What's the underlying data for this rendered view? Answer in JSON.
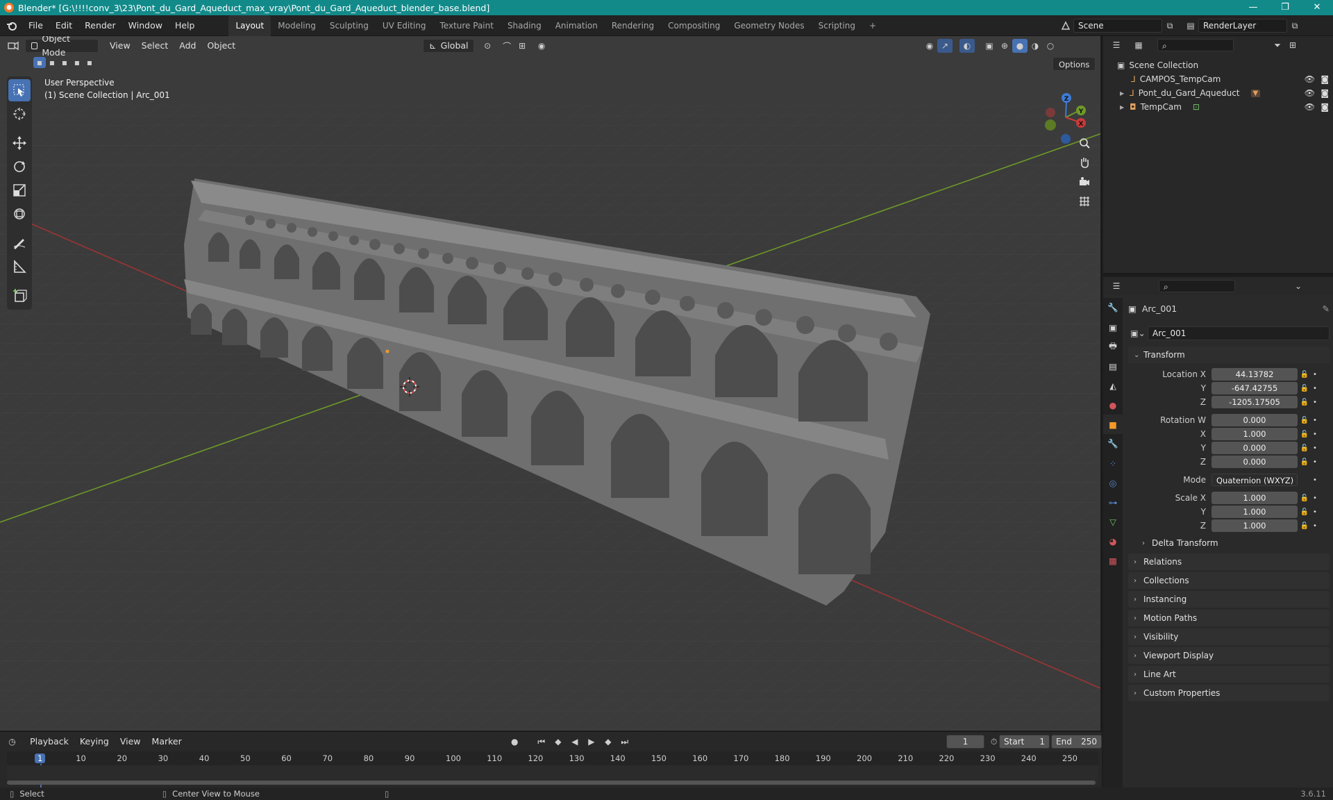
{
  "window": {
    "title": "Blender* [G:\\!!!!conv_3\\23\\Pont_du_Gard_Aqueduct_max_vray\\Pont_du_Gard_Aqueduct_blender_base.blend]",
    "controls": [
      "—",
      "❐",
      "✕"
    ]
  },
  "menu": [
    "File",
    "Edit",
    "Render",
    "Window",
    "Help"
  ],
  "workspaces": [
    "Layout",
    "Modeling",
    "Sculpting",
    "UV Editing",
    "Texture Paint",
    "Shading",
    "Animation",
    "Rendering",
    "Compositing",
    "Geometry Nodes",
    "Scripting"
  ],
  "workspace_add": "+",
  "scene": {
    "name": "Scene",
    "render_layer": "RenderLayer"
  },
  "viewport": {
    "mode": "Object Mode",
    "menus": [
      "View",
      "Select",
      "Add",
      "Object"
    ],
    "transform_orientation": "Global",
    "options_label": "Options",
    "info_line1": "User Perspective",
    "info_line2": "(1) Scene Collection | Arc_001"
  },
  "outliner": {
    "root": "Scene Collection",
    "items": [
      {
        "name": "CAMPOS_TempCam",
        "expandable": false
      },
      {
        "name": "Pont_du_Gard_Aqueduct",
        "expandable": true
      },
      {
        "name": "TempCam",
        "expandable": true
      }
    ]
  },
  "properties": {
    "object_name": "Arc_001",
    "data_name": "Arc_001",
    "transform_title": "Transform",
    "location": {
      "label": "Location X",
      "x": "44.13782",
      "y": "-647.42755",
      "z": "-1205.17505"
    },
    "rotation": {
      "label": "Rotation W",
      "w": "0.000",
      "x": "1.000",
      "y": "0.000",
      "z": "0.000"
    },
    "axis_labels": {
      "x": "X",
      "y": "Y",
      "z": "Z"
    },
    "mode_label": "Mode",
    "mode_value": "Quaternion (WXYZ)",
    "scale": {
      "label": "Scale X",
      "x": "1.000",
      "y": "1.000",
      "z": "1.000"
    },
    "delta_transform": "Delta Transform",
    "panels": [
      "Relations",
      "Collections",
      "Instancing",
      "Motion Paths",
      "Visibility",
      "Viewport Display",
      "Line Art",
      "Custom Properties"
    ]
  },
  "timeline": {
    "menus": [
      "Playback",
      "Keying",
      "View",
      "Marker"
    ],
    "current_frame": "1",
    "start_label": "Start",
    "start": "1",
    "end_label": "End",
    "end": "250",
    "ruler": [
      "1",
      "10",
      "20",
      "30",
      "40",
      "50",
      "60",
      "70",
      "80",
      "90",
      "100",
      "110",
      "120",
      "130",
      "140",
      "150",
      "160",
      "170",
      "180",
      "190",
      "200",
      "210",
      "220",
      "230",
      "240",
      "250"
    ]
  },
  "status": {
    "left": "Select",
    "middle": "Center View to Mouse",
    "version": "3.6.11"
  },
  "colors": {
    "accent": "#4772b3",
    "titlebar": "#138a8a",
    "x_axis": "#c83a3a",
    "y_axis": "#6e9a28",
    "z_axis": "#3d7bd6"
  }
}
